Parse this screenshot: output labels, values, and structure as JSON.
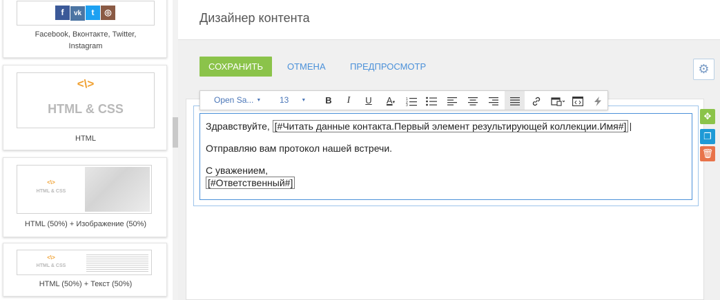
{
  "left_panel": {
    "blocks": [
      {
        "label": "Facebook, Вконтакте, Twitter, Instagram",
        "icons": [
          "facebook-icon",
          "vk-icon",
          "twitter-icon",
          "instagram-icon"
        ]
      },
      {
        "label": "HTML",
        "thumb_text": "HTML & CSS",
        "thumb_symbol": "<\\>"
      },
      {
        "label": "HTML (50%) + Изображение (50%)",
        "thumb_text": "HTML & CSS",
        "thumb_symbol": "<\\>"
      },
      {
        "label": "HTML (50%) + Текст (50%)",
        "thumb_text": "HTML & CSS",
        "thumb_symbol": "<\\>"
      }
    ],
    "social_glyphs": {
      "facebook": "f",
      "vk": "vk",
      "twitter": "t",
      "instagram": "◎"
    },
    "social_colors": {
      "facebook": "#3b5998",
      "vk": "#4c75a3",
      "twitter": "#1da1f2",
      "instagram": "#8a5a44"
    }
  },
  "header": {
    "title": "Дизайнер контента"
  },
  "actions": {
    "save": "СОХРАНИТЬ",
    "cancel": "ОТМЕНА",
    "preview": "ПРЕДПРОСМОТР"
  },
  "toolbar": {
    "font_family": "Open Sa...",
    "font_size": "13",
    "icons": [
      "bold-icon",
      "italic-icon",
      "underline-icon",
      "text-color-icon",
      "ordered-list-icon",
      "unordered-list-icon",
      "align-left-icon",
      "align-center-icon",
      "align-right-icon",
      "align-justify-icon",
      "link-icon",
      "insert-macro-icon",
      "source-code-icon",
      "lightning-icon"
    ]
  },
  "content": {
    "greeting": "Здравствуйте,",
    "greeting_macro": "[#Читать данные контакта.Первый элемент результирующей коллекции.Имя#]",
    "body": "Отправляю вам протокол нашей встречи.",
    "closing": "С уважением,",
    "signature_macro": "[#Ответственный#]"
  },
  "colors": {
    "accent_green": "#8bc34a",
    "link_blue": "#4a90d9",
    "move_green": "#8bc34a",
    "copy_blue": "#1e9ad6",
    "delete_red": "#e8734a",
    "thumb_orange": "#f0a030"
  }
}
